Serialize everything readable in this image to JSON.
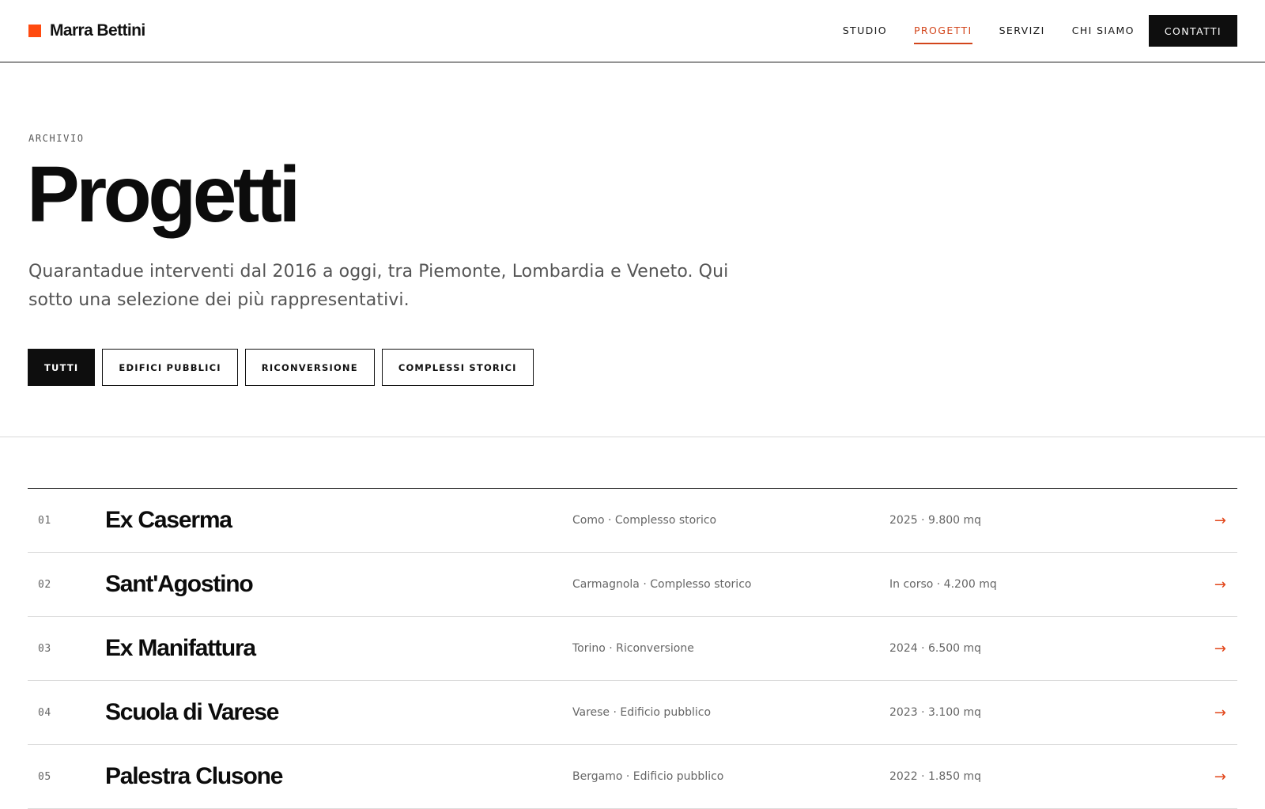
{
  "brand": {
    "name": "Marra Bettini",
    "accent_color": "#ff4a0f"
  },
  "nav": {
    "items": [
      {
        "label": "STUDIO",
        "active": false
      },
      {
        "label": "PROGETTI",
        "active": true
      },
      {
        "label": "SERVIZI",
        "active": false
      },
      {
        "label": "CHI SIAMO",
        "active": false
      }
    ],
    "cta_label": "CONTATTI"
  },
  "intro": {
    "eyebrow": "ARCHIVIO",
    "title": "Progetti",
    "lead": "Quarantadue interventi dal 2016 a oggi, tra Piemonte, Lombardia e Veneto. Qui sotto una selezione dei più rappresentativi."
  },
  "filters": [
    {
      "label": "TUTTI",
      "active": true
    },
    {
      "label": "EDIFICI PUBBLICI",
      "active": false
    },
    {
      "label": "RICONVERSIONE",
      "active": false
    },
    {
      "label": "COMPLESSI STORICI",
      "active": false
    }
  ],
  "projects": [
    {
      "num": "01",
      "name": "Ex Caserma",
      "meta": "Como · Complesso storico",
      "info": "2025 · 9.800 mq",
      "arrow": "→"
    },
    {
      "num": "02",
      "name": "Sant'Agostino",
      "meta": "Carmagnola · Complesso storico",
      "info": "In corso · 4.200 mq",
      "arrow": "→"
    },
    {
      "num": "03",
      "name": "Ex Manifattura",
      "meta": "Torino · Riconversione",
      "info": "2024 · 6.500 mq",
      "arrow": "→"
    },
    {
      "num": "04",
      "name": "Scuola di Varese",
      "meta": "Varese · Edificio pubblico",
      "info": "2023 · 3.100 mq",
      "arrow": "→"
    },
    {
      "num": "05",
      "name": "Palestra Clusone",
      "meta": "Bergamo · Edificio pubblico",
      "info": "2022 · 1.850 mq",
      "arrow": "→"
    }
  ],
  "colors": {
    "active_nav": "#d2451b",
    "arrow": "#e2461a",
    "ink": "#0e0e0e"
  }
}
